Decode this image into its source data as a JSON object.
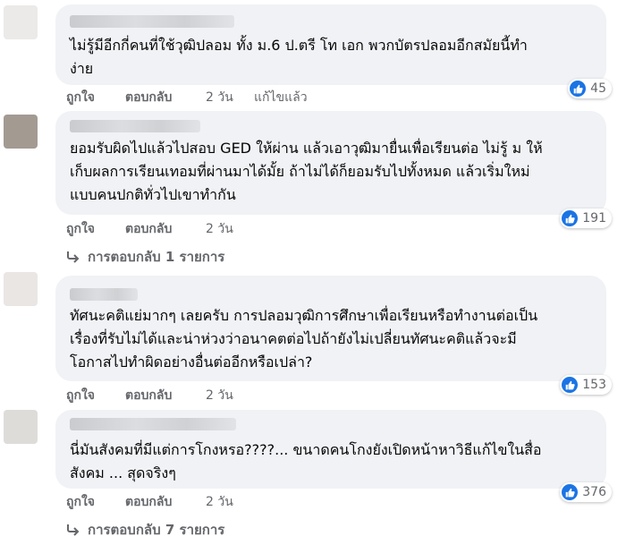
{
  "comments": [
    {
      "text_lines": [
        "ไม่รู้มีอีกกี่คนที่ใช้วุฒิปลอม ทั้ง ม.6 ป.ตรี โท เอก พวกบัตรปลอมอีกสมัยนี้ทำ",
        "ง่าย"
      ],
      "like_label": "ถูกใจ",
      "reply_label": "ตอบกลับ",
      "time": "2 วัน",
      "edited": "แก้ไขแล้ว",
      "reactions": "45"
    },
    {
      "text_lines": [
        "ยอมรับผิดไปแล้วไปสอบ GED ให้ผ่าน แล้วเอาวุฒิมายื่นเพื่อเรียนต่อ ไม่รู้ ม ให้",
        "เก็บผลการเรียนเทอมที่ผ่านมาได้มั้ย ถ้าไม่ได้ก็ยอมรับไปทั้งหมด แล้วเริ่มใหม่",
        "แบบคนปกติทั่วไปเขาทำกัน"
      ],
      "like_label": "ถูกใจ",
      "reply_label": "ตอบกลับ",
      "time": "2 วัน",
      "reactions": "191",
      "replies_label": "การตอบกลับ 1 รายการ"
    },
    {
      "text_lines": [
        "ทัศนะคติแย่มากๆ เลยครับ การปลอมวุฒิการศึกษาเพื่อเรียนหรือทำงานต่อเป็น",
        "เรื่องที่รับไม่ได้และน่าห่วงว่าอนาคตต่อไปถ้ายังไม่เปลี่ยนทัศนะคติแล้วจะมี",
        "โอกาสไปทำผิดอย่างอื่นต่ออีกหรือเปล่า?"
      ],
      "like_label": "ถูกใจ",
      "reply_label": "ตอบกลับ",
      "time": "2 วัน",
      "reactions": "153"
    },
    {
      "text_lines": [
        "นี่มันสังคมที่มีแต่การโกงหรอ????... ขนาดคนโกงยังเปิดหน้าหาวิธีแก้ไขในสื่อ",
        "สังคม ... สุดจริงๆ"
      ],
      "like_label": "ถูกใจ",
      "reply_label": "ตอบกลับ",
      "time": "2 วัน",
      "reactions": "376",
      "replies_label": "การตอบกลับ 7 รายการ"
    }
  ],
  "colors": {
    "bubble": "#f0f2f5",
    "meta": "#65676b",
    "like_blue": "#1b74e4"
  },
  "icons": {
    "reaction": "thumbs-up-icon",
    "replies": "reply-arrow-icon"
  }
}
